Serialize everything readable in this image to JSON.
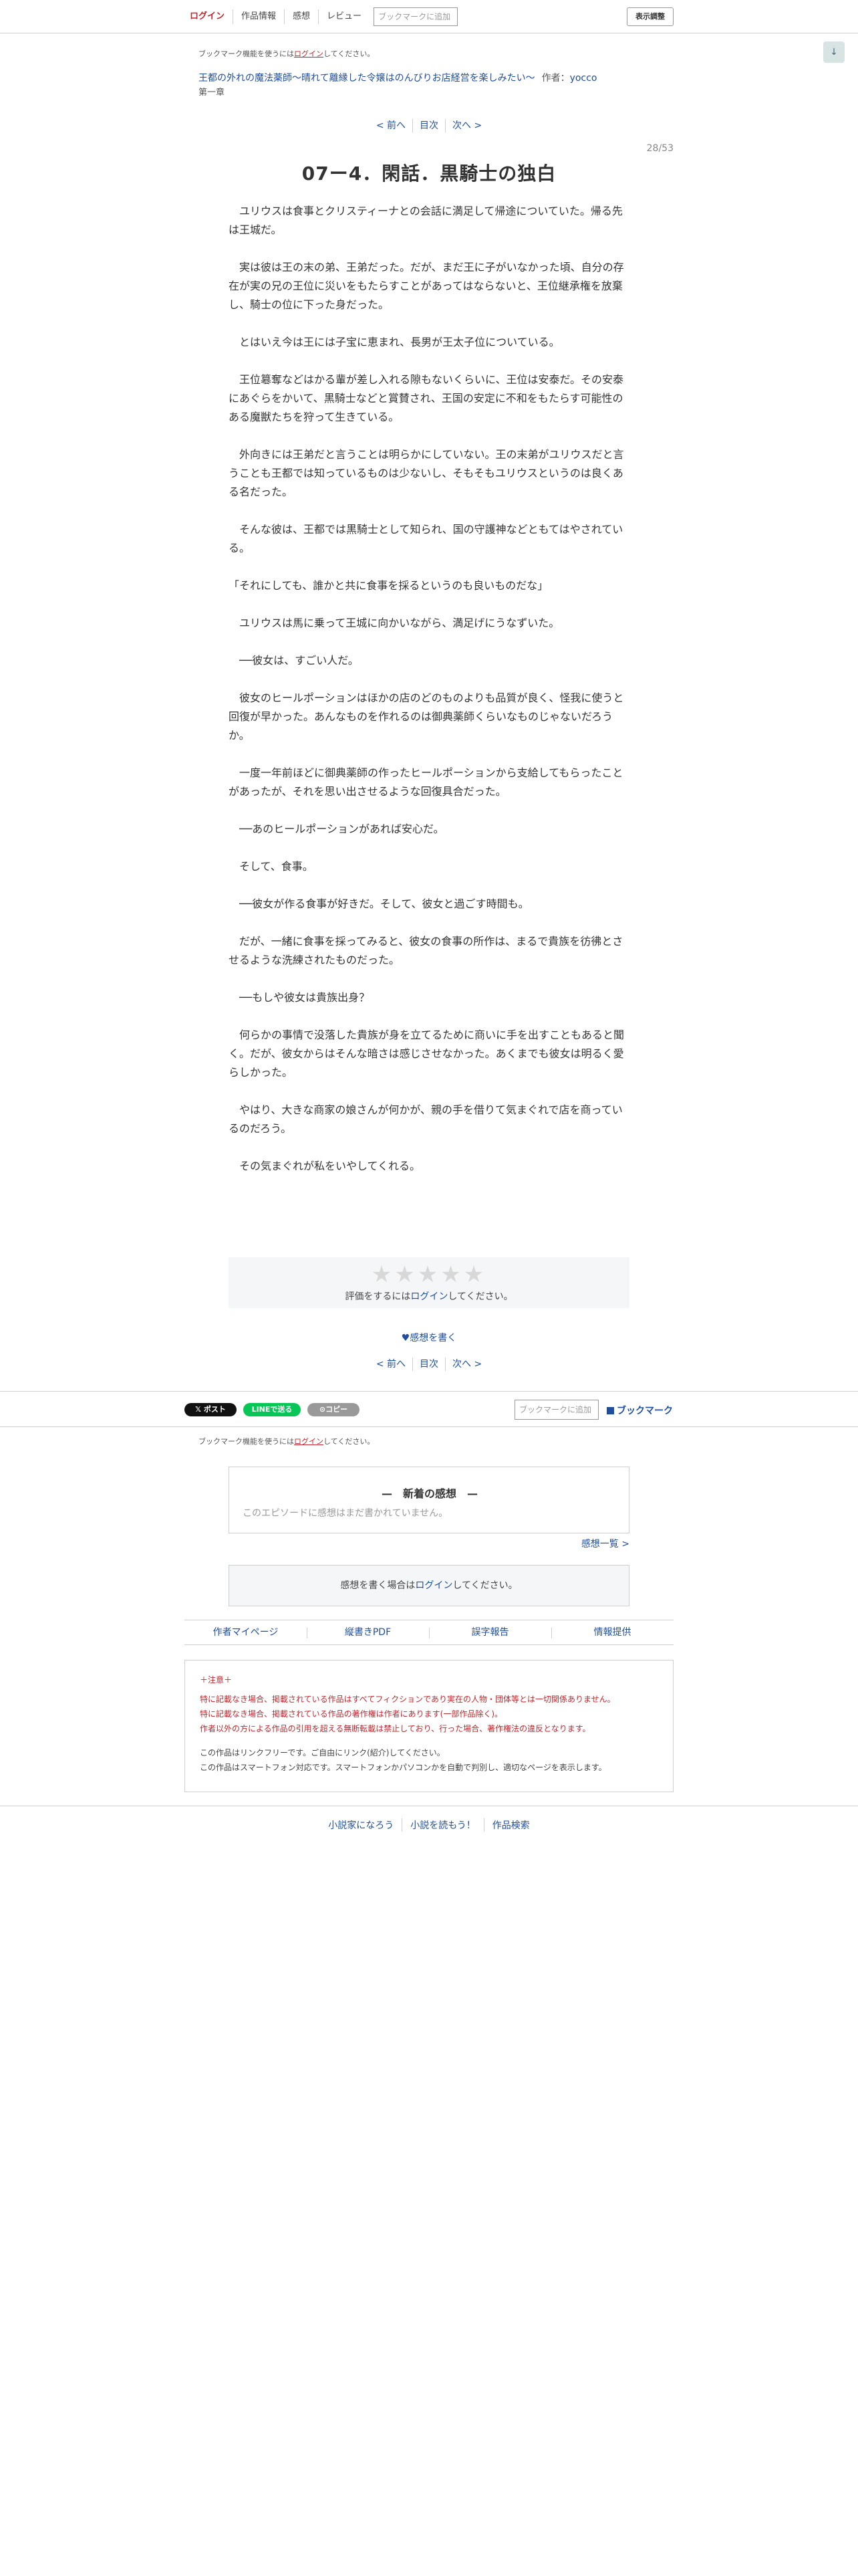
{
  "header": {
    "nav": [
      "ログイン",
      "作品情報",
      "感想",
      "レビュー"
    ],
    "bookmark_placeholder": "ブックマークに追加",
    "display_button": "表示調整",
    "scroll_icon": "↓"
  },
  "bookmark_notice": {
    "prefix": "ブックマーク機能を使うには",
    "login": "ログイン",
    "suffix": "してください。"
  },
  "series": {
    "title": "王都の外れの魔法薬師〜晴れて離縁した令嬢はのんびりお店経営を楽しみたい〜",
    "author_label": "作者：",
    "author": "yocco",
    "chapter": "第一章"
  },
  "pager": {
    "prev": "< 前へ",
    "toc": "目次",
    "next": "次へ >"
  },
  "page_count": "28/53",
  "episode_title": "07ー4．閑話．黒騎士の独白",
  "body": [
    "　ユリウスは食事とクリスティーナとの会話に満足して帰途についていた。帰る先は王城だ。",
    "　実は彼は王の末の弟、王弟だった。だが、まだ王に子がいなかった頃、自分の存在が実の兄の王位に災いをもたらすことがあってはならないと、王位継承権を放棄し、騎士の位に下った身だった。",
    "　とはいえ今は王には子宝に恵まれ、長男が王太子位についている。",
    "　王位簒奪などはかる輩が差し入れる隙もないくらいに、王位は安泰だ。その安泰にあぐらをかいて、黒騎士などと賞賛され、王国の安定に不和をもたらす可能性のある魔獣たちを狩って生きている。",
    "　外向きには王弟だと言うことは明らかにしていない。王の末弟がユリウスだと言うことも王都では知っているものは少ないし、そもそもユリウスというのは良くある名だった。",
    "　そんな彼は、王都では黒騎士として知られ、国の守護神などともてはやされている。",
    "「それにしても、誰かと共に食事を採るというのも良いものだな」",
    "　ユリウスは馬に乗って王城に向かいながら、満足げにうなずいた。",
    "　──彼女は、すごい人だ。",
    "　彼女のヒールポーションはほかの店のどのものよりも品質が良く、怪我に使うと回復が早かった。あんなものを作れるのは御典薬師くらいなものじゃないだろうか。",
    "　一度一年前ほどに御典薬師の作ったヒールポーションから支給してもらったことがあったが、それを思い出させるような回復具合だった。",
    "　──あのヒールポーションがあれば安心だ。",
    "　そして、食事。",
    "　──彼女が作る食事が好きだ。そして、彼女と過ごす時間も。",
    "　だが、一緒に食事を採ってみると、彼女の食事の所作は、まるで貴族を彷彿とさせるような洗練されたものだった。",
    "　──もしや彼女は貴族出身？",
    "　何らかの事情で没落した貴族が身を立てるために商いに手を出すこともあると聞く。だが、彼女からはそんな暗さは感じさせなかった。あくまでも彼女は明るく愛らしかった。",
    "　やはり、大きな商家の娘さんが何かが、親の手を借りて気まぐれで店を商っているのだろう。",
    "　その気まぐれが私をいやしてくれる。"
  ],
  "rating": {
    "stars": "★★★★★",
    "prefix": "評価をするには",
    "login": "ログイン",
    "suffix": "してください。"
  },
  "write_review": "♥感想を書く",
  "share": {
    "x": "𝕏 ポスト",
    "line": "LINEで送る",
    "copy": "⊙コピー",
    "bookmark_placeholder": "ブックマークに追加",
    "bookmark_link": "ブックマーク"
  },
  "reviews": {
    "heading": "—　新着の感想　—",
    "empty": "このエピソードに感想はまだ書かれていません。",
    "list_link": "感想一覧 >"
  },
  "review_login": {
    "prefix": "感想を書く場合は",
    "login": "ログイン",
    "suffix": "してください。"
  },
  "bottom_nav": [
    "作者マイページ",
    "縦書きPDF",
    "誤字報告",
    "情報提供"
  ],
  "notice": {
    "title": "＋注意＋",
    "red_lines": [
      "特に記載なき場合、掲載されている作品はすべてフィクションであり実在の人物・団体等とは一切関係ありません。",
      "特に記載なき場合、掲載されている作品の著作権は作者にあります(一部作品除く)。",
      "作者以外の方による作品の引用を超える無断転載は禁止しており、行った場合、著作権法の違反となります。"
    ],
    "gray_lines": [
      "この作品はリンクフリーです。ご自由にリンク(紹介)してください。",
      "この作品はスマートフォン対応です。スマートフォンかパソコンかを自動で判別し、適切なページを表示します。"
    ]
  },
  "footer": [
    "小説家になろう",
    "小説を読もう！",
    "作品検索"
  ]
}
